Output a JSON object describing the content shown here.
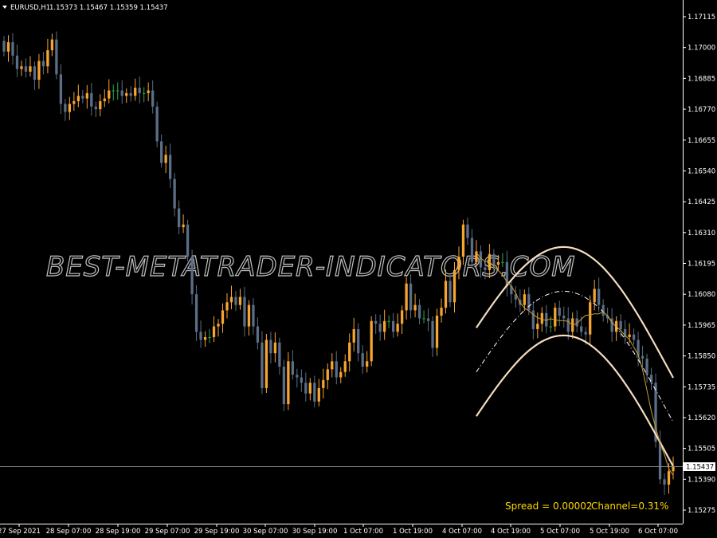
{
  "header": {
    "symbol_label": "EURUSD,H1",
    "ohlc_label": "1.15373 1.15467 1.15359 1.15437",
    "menu_icon": "triangle-down-icon"
  },
  "status": {
    "spread_label": "Spread = 0.00002",
    "channel_label": "Channel=0.31%",
    "color": "#ffd700"
  },
  "watermark": "BEST-METATRADER-INDICATORS.COM",
  "colors": {
    "background": "#000000",
    "axis": "#ffffff",
    "bull_candle": "#f7a531",
    "bear_candle": "#5b6e85",
    "doji_candle": "#2fa84f",
    "channel_band": "#f4dcc0",
    "channel_mid": "#ffffff",
    "smooth_line": "#c8a030",
    "price_line": "#8a8a8a"
  },
  "chart_data": {
    "type": "candlestick",
    "symbol": "EURUSD",
    "timeframe": "H1",
    "ylim": [
      1.1522,
      1.1722
    ],
    "y_ticks": [
      "1.17115",
      "1.17000",
      "1.16885",
      "1.16770",
      "1.16655",
      "1.16540",
      "1.16425",
      "1.16310",
      "1.16195",
      "1.16080",
      "1.15965",
      "1.15850",
      "1.15735",
      "1.15620",
      "1.15505",
      "1.15390",
      "1.15275"
    ],
    "x_ticks": [
      "27 Sep 2021",
      "28 Sep 07:00",
      "28 Sep 19:00",
      "29 Sep 07:00",
      "29 Sep 19:00",
      "30 Sep 07:00",
      "30 Sep 19:00",
      "1 Oct 07:00",
      "1 Oct 19:00",
      "4 Oct 07:00",
      "4 Oct 19:00",
      "5 Oct 07:00",
      "5 Oct 19:00",
      "6 Oct 07:00"
    ],
    "current_price": 1.15437,
    "current_price_label": "1.15437",
    "closes": [
      1.16985,
      1.1702,
      1.1697,
      1.1692,
      1.1693,
      1.1691,
      1.1693,
      1.1688,
      1.1695,
      1.1693,
      1.1699,
      1.1703,
      1.169,
      1.1679,
      1.1676,
      1.1679,
      1.168,
      1.1682,
      1.1681,
      1.1683,
      1.1678,
      1.1677,
      1.168,
      1.1681,
      1.1684,
      1.1684,
      1.1684,
      1.1682,
      1.1683,
      1.1682,
      1.1685,
      1.1683,
      1.1683,
      1.1684,
      1.1678,
      1.1665,
      1.1657,
      1.166,
      1.1651,
      1.164,
      1.1633,
      1.1634,
      1.1622,
      1.1608,
      1.1594,
      1.1591,
      1.1592,
      1.1592,
      1.1596,
      1.1597,
      1.1602,
      1.1605,
      1.1607,
      1.1604,
      1.1607,
      1.1596,
      1.1604,
      1.1596,
      1.159,
      1.1573,
      1.1591,
      1.1586,
      1.159,
      1.1581,
      1.1567,
      1.1583,
      1.1578,
      1.1577,
      1.1575,
      1.1571,
      1.1575,
      1.1568,
      1.1573,
      1.1576,
      1.158,
      1.1583,
      1.1577,
      1.1579,
      1.1583,
      1.159,
      1.1595,
      1.1586,
      1.1581,
      1.1583,
      1.1598,
      1.1597,
      1.1594,
      1.1598,
      1.1598,
      1.1594,
      1.1597,
      1.1602,
      1.1612,
      1.1602,
      1.1604,
      1.1599,
      1.1599,
      1.1598,
      1.1588,
      1.16,
      1.1603,
      1.1613,
      1.1605,
      1.1617,
      1.1622,
      1.1634,
      1.1629,
      1.162,
      1.1624,
      1.1618,
      1.1617,
      1.1623,
      1.1619,
      1.162,
      1.162,
      1.1611,
      1.1608,
      1.1606,
      1.1604,
      1.1608,
      1.1602,
      1.1595,
      1.1597,
      1.1601,
      1.1596,
      1.1596,
      1.1603,
      1.16,
      1.1599,
      1.1594,
      1.1599,
      1.1596,
      1.1594,
      1.1593,
      1.1605,
      1.161,
      1.1604,
      1.16,
      1.1599,
      1.1594,
      1.1598,
      1.1595,
      1.1592,
      1.1593,
      1.1591,
      1.1585,
      1.1584,
      1.1578,
      1.1575,
      1.1553,
      1.1539,
      1.1537,
      1.1542,
      1.15437
    ]
  }
}
